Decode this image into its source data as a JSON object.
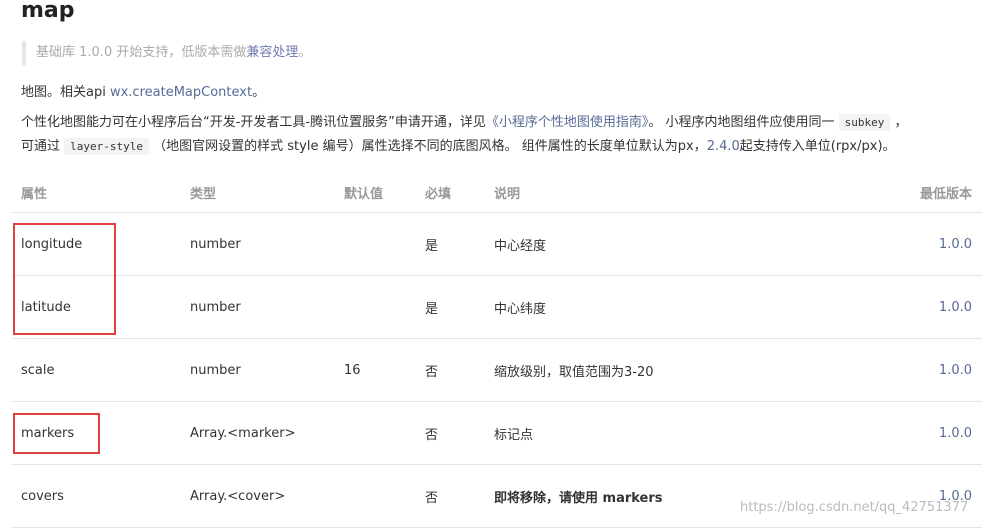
{
  "page": {
    "title": "map",
    "note": {
      "prefix": "基础库 1.0.0 开始支持，低版本需做",
      "link": "兼容处理",
      "suffix": "。"
    },
    "intro": {
      "text": "地图。相关api ",
      "link": "wx.createMapContext",
      "suffix": "。"
    },
    "desc1": {
      "a": "个性化地图能力可在小程序后台“开发-开发者工具-腾讯位置服务”申请开通，详见",
      "link": "《小程序个性地图使用指南》",
      "b": "。 小程序内地图组件应使用同一",
      "code": "subkey",
      "c": "，"
    },
    "desc2": {
      "a": "可通过",
      "code": "layer-style",
      "b": "（地图官网设置的样式 style 编号）属性选择不同的底图风格。 组件属性的长度单位默认为px，",
      "link": "2.4.0",
      "c": "起支持传入单位(rpx/px)。"
    }
  },
  "table": {
    "headers": [
      "属性",
      "类型",
      "默认值",
      "必填",
      "说明",
      "最低版本"
    ],
    "rows": [
      {
        "attr": "longitude",
        "type": "number",
        "default": "",
        "required": "是",
        "desc": "中心经度",
        "version": "1.0.0"
      },
      {
        "attr": "latitude",
        "type": "number",
        "default": "",
        "required": "是",
        "desc": "中心纬度",
        "version": "1.0.0"
      },
      {
        "attr": "scale",
        "type": "number",
        "default": "16",
        "required": "否",
        "desc": "缩放级别，取值范围为3-20",
        "version": "1.0.0"
      },
      {
        "attr": "markers",
        "type": "Array.<marker>",
        "default": "",
        "required": "否",
        "desc": "标记点",
        "version": "1.0.0"
      },
      {
        "attr": "covers",
        "type": "Array.<cover>",
        "default": "",
        "required": "否",
        "desc": "即将移除，请使用 markers",
        "version": "1.0.0"
      }
    ]
  },
  "watermark": "https://blog.csdn.net/qq_42751377"
}
